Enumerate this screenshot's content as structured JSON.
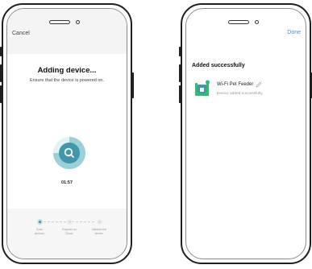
{
  "left_screen": {
    "cancel_label": "Cancel",
    "title": "Adding device...",
    "subtitle": "Ensure that the device is powered on.",
    "timer": "01:57",
    "search_icon": "search-icon",
    "steps": [
      {
        "label_line1": "Scan",
        "label_line2": "devices.",
        "state": "active"
      },
      {
        "label_line1": "Register on",
        "label_line2": "Cloud.",
        "state": "pending"
      },
      {
        "label_line1": "Initialize the",
        "label_line2": "device.",
        "state": "pending"
      }
    ]
  },
  "right_screen": {
    "done_label": "Done",
    "title": "Added successfully",
    "device": {
      "name": "Wi-Fi Pet Feeder",
      "status": "Device added successfully.",
      "icon": "pet-feeder-icon",
      "edit_icon": "pencil-icon"
    }
  },
  "colors": {
    "accent": "#3f97a8",
    "accent_light": "#9ccfd7",
    "device_icon_green": "#2dbe6c",
    "done_blue": "#4a90c8"
  }
}
